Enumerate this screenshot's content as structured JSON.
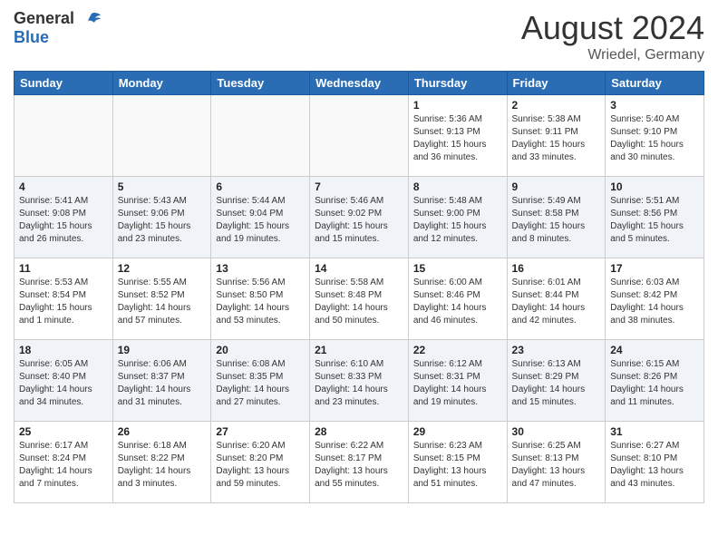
{
  "header": {
    "logo_general": "General",
    "logo_blue": "Blue",
    "month_year": "August 2024",
    "location": "Wriedel, Germany"
  },
  "weekdays": [
    "Sunday",
    "Monday",
    "Tuesday",
    "Wednesday",
    "Thursday",
    "Friday",
    "Saturday"
  ],
  "weeks": [
    [
      {
        "day": "",
        "info": ""
      },
      {
        "day": "",
        "info": ""
      },
      {
        "day": "",
        "info": ""
      },
      {
        "day": "",
        "info": ""
      },
      {
        "day": "1",
        "info": "Sunrise: 5:36 AM\nSunset: 9:13 PM\nDaylight: 15 hours\nand 36 minutes."
      },
      {
        "day": "2",
        "info": "Sunrise: 5:38 AM\nSunset: 9:11 PM\nDaylight: 15 hours\nand 33 minutes."
      },
      {
        "day": "3",
        "info": "Sunrise: 5:40 AM\nSunset: 9:10 PM\nDaylight: 15 hours\nand 30 minutes."
      }
    ],
    [
      {
        "day": "4",
        "info": "Sunrise: 5:41 AM\nSunset: 9:08 PM\nDaylight: 15 hours\nand 26 minutes."
      },
      {
        "day": "5",
        "info": "Sunrise: 5:43 AM\nSunset: 9:06 PM\nDaylight: 15 hours\nand 23 minutes."
      },
      {
        "day": "6",
        "info": "Sunrise: 5:44 AM\nSunset: 9:04 PM\nDaylight: 15 hours\nand 19 minutes."
      },
      {
        "day": "7",
        "info": "Sunrise: 5:46 AM\nSunset: 9:02 PM\nDaylight: 15 hours\nand 15 minutes."
      },
      {
        "day": "8",
        "info": "Sunrise: 5:48 AM\nSunset: 9:00 PM\nDaylight: 15 hours\nand 12 minutes."
      },
      {
        "day": "9",
        "info": "Sunrise: 5:49 AM\nSunset: 8:58 PM\nDaylight: 15 hours\nand 8 minutes."
      },
      {
        "day": "10",
        "info": "Sunrise: 5:51 AM\nSunset: 8:56 PM\nDaylight: 15 hours\nand 5 minutes."
      }
    ],
    [
      {
        "day": "11",
        "info": "Sunrise: 5:53 AM\nSunset: 8:54 PM\nDaylight: 15 hours\nand 1 minute."
      },
      {
        "day": "12",
        "info": "Sunrise: 5:55 AM\nSunset: 8:52 PM\nDaylight: 14 hours\nand 57 minutes."
      },
      {
        "day": "13",
        "info": "Sunrise: 5:56 AM\nSunset: 8:50 PM\nDaylight: 14 hours\nand 53 minutes."
      },
      {
        "day": "14",
        "info": "Sunrise: 5:58 AM\nSunset: 8:48 PM\nDaylight: 14 hours\nand 50 minutes."
      },
      {
        "day": "15",
        "info": "Sunrise: 6:00 AM\nSunset: 8:46 PM\nDaylight: 14 hours\nand 46 minutes."
      },
      {
        "day": "16",
        "info": "Sunrise: 6:01 AM\nSunset: 8:44 PM\nDaylight: 14 hours\nand 42 minutes."
      },
      {
        "day": "17",
        "info": "Sunrise: 6:03 AM\nSunset: 8:42 PM\nDaylight: 14 hours\nand 38 minutes."
      }
    ],
    [
      {
        "day": "18",
        "info": "Sunrise: 6:05 AM\nSunset: 8:40 PM\nDaylight: 14 hours\nand 34 minutes."
      },
      {
        "day": "19",
        "info": "Sunrise: 6:06 AM\nSunset: 8:37 PM\nDaylight: 14 hours\nand 31 minutes."
      },
      {
        "day": "20",
        "info": "Sunrise: 6:08 AM\nSunset: 8:35 PM\nDaylight: 14 hours\nand 27 minutes."
      },
      {
        "day": "21",
        "info": "Sunrise: 6:10 AM\nSunset: 8:33 PM\nDaylight: 14 hours\nand 23 minutes."
      },
      {
        "day": "22",
        "info": "Sunrise: 6:12 AM\nSunset: 8:31 PM\nDaylight: 14 hours\nand 19 minutes."
      },
      {
        "day": "23",
        "info": "Sunrise: 6:13 AM\nSunset: 8:29 PM\nDaylight: 14 hours\nand 15 minutes."
      },
      {
        "day": "24",
        "info": "Sunrise: 6:15 AM\nSunset: 8:26 PM\nDaylight: 14 hours\nand 11 minutes."
      }
    ],
    [
      {
        "day": "25",
        "info": "Sunrise: 6:17 AM\nSunset: 8:24 PM\nDaylight: 14 hours\nand 7 minutes."
      },
      {
        "day": "26",
        "info": "Sunrise: 6:18 AM\nSunset: 8:22 PM\nDaylight: 14 hours\nand 3 minutes."
      },
      {
        "day": "27",
        "info": "Sunrise: 6:20 AM\nSunset: 8:20 PM\nDaylight: 13 hours\nand 59 minutes."
      },
      {
        "day": "28",
        "info": "Sunrise: 6:22 AM\nSunset: 8:17 PM\nDaylight: 13 hours\nand 55 minutes."
      },
      {
        "day": "29",
        "info": "Sunrise: 6:23 AM\nSunset: 8:15 PM\nDaylight: 13 hours\nand 51 minutes."
      },
      {
        "day": "30",
        "info": "Sunrise: 6:25 AM\nSunset: 8:13 PM\nDaylight: 13 hours\nand 47 minutes."
      },
      {
        "day": "31",
        "info": "Sunrise: 6:27 AM\nSunset: 8:10 PM\nDaylight: 13 hours\nand 43 minutes."
      }
    ]
  ]
}
